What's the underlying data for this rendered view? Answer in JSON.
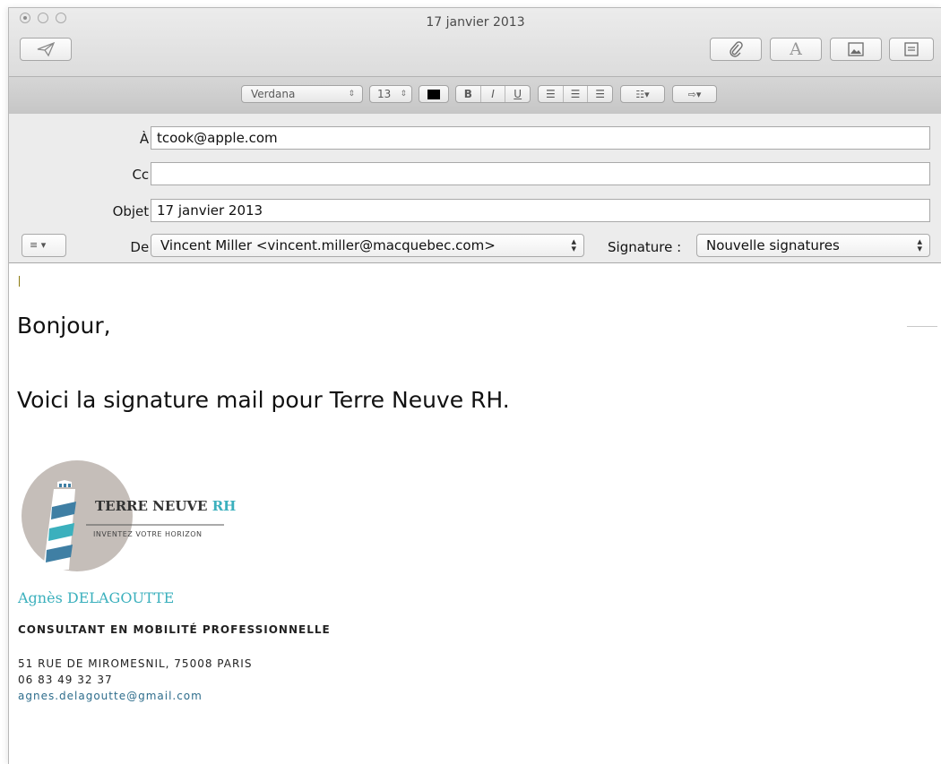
{
  "window": {
    "title": "17 janvier 2013"
  },
  "toolbar": {
    "send_icon": "paper-plane-icon",
    "attach_icon": "paperclip-icon",
    "fonts_icon": "font-A-icon",
    "photo_icon": "photo-browser-icon",
    "template_icon": "stationery-icon"
  },
  "format_bar": {
    "font_family": "Verdana",
    "font_size": "13",
    "text_color": "#000000",
    "bold": "B",
    "italic": "I",
    "underline": "U",
    "list_icon": "list-icon",
    "indent_icon": "indent-arrow-icon"
  },
  "headers": {
    "to_label": "À :",
    "to_value": "tcook@apple.com",
    "cc_label": "Cc :",
    "cc_value": "",
    "subject_label": "Objet :",
    "subject_value": "17 janvier 2013",
    "from_label": "De :",
    "from_value": "Vincent Miller <vincent.miller@macquebec.com>",
    "signature_label": "Signature :",
    "signature_value": "Nouvelle signatures"
  },
  "body": {
    "greeting": "Bonjour,",
    "message": "Voici la signature mail pour Terre Neuve RH."
  },
  "signature": {
    "logo_name": "TERRE NEUVE",
    "logo_rh": "RH",
    "logo_tagline": "INVENTEZ VOTRE HORIZON",
    "name": "Agnès DELAGOUTTE",
    "title": "CONSULTANT EN MOBILITÉ PROFESSIONNELLE",
    "address": "51 RUE DE MIROMESNIL, 75008 PARIS",
    "phone": "06 83 49 32 37",
    "email": "agnes.delagoutte@gmail.com",
    "brand_color": "#3bb0bd",
    "stripe_color": "#3f7fa4"
  }
}
